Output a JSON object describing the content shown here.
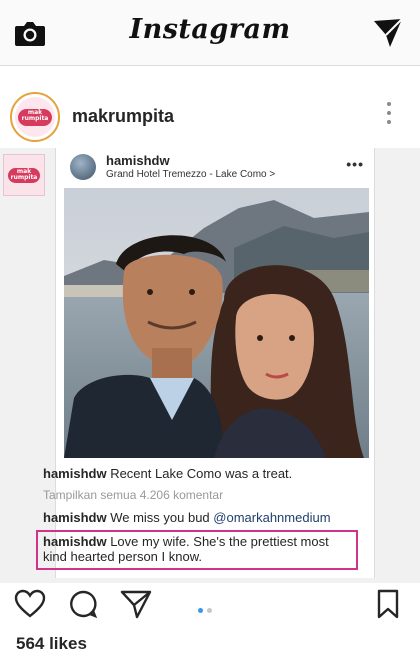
{
  "topbar": {
    "title": "Instagram",
    "camera_icon": "camera-icon",
    "direct_icon": "paper-plane-icon"
  },
  "post": {
    "username": "makrumpita",
    "avatar_text": "mak rumpita",
    "more_icon": "more-vertical-icon",
    "sticker_text": "mak rumpita"
  },
  "screenshot": {
    "username": "hamishdw",
    "location": "Grand Hotel Tremezzo - Lake Como >",
    "more": "•••",
    "comments": [
      {
        "user": "hamishdw",
        "text": " Recent Lake Como was a treat."
      },
      {
        "text": "Tampilkan semua 4.206 komentar"
      },
      {
        "user": "hamishdw",
        "text": " We miss you bud ",
        "mention": "@omarkahnmedium"
      },
      {
        "user": "hamishdw",
        "text": " Love my wife. She's the prettiest most kind hearted person I know."
      }
    ]
  },
  "actions": {
    "icons": [
      "heart-icon",
      "comment-icon",
      "share-icon",
      "bookmark-icon"
    ],
    "carousel_active": 0,
    "carousel_count": 2
  },
  "likes": "564 likes",
  "colors": {
    "highlight": "#d0338a",
    "carousel_active": "#3897f0",
    "carousel_inactive": "#c7c7c7",
    "mention": "#20406f"
  }
}
